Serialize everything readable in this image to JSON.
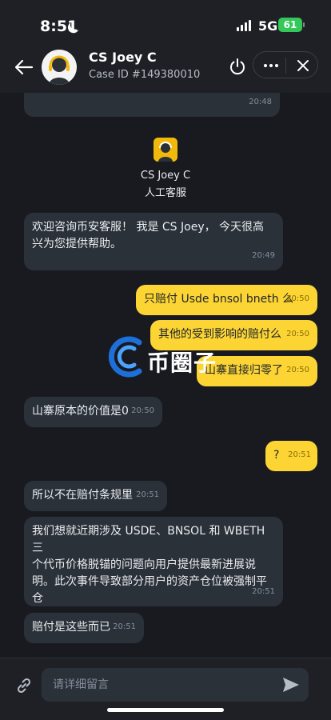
{
  "status_bar": {
    "time": "8:51",
    "network": "5G",
    "battery": "61"
  },
  "header": {
    "agent_name": "CS Joey C",
    "case_id": "Case ID #149380010"
  },
  "chat": {
    "prev_time": "20:48",
    "agent_card": {
      "name": "CS Joey C",
      "role": "人工客服"
    },
    "messages": [
      {
        "dir": "in",
        "lines": [
          "欢迎咨询币安客服！ 我是 CS Joey， 今天很高",
          "兴为您提供帮助。"
        ],
        "time": "20:49"
      },
      {
        "dir": "out",
        "lines": [
          "只赔付 Usde bnsol bneth 么"
        ],
        "time": "20:50"
      },
      {
        "dir": "out",
        "lines": [
          "其他的受到影响的赔付么"
        ],
        "time": "20:50"
      },
      {
        "dir": "out",
        "lines": [
          "山寨直接归零了"
        ],
        "time": "20:50"
      },
      {
        "dir": "in",
        "lines": [
          "山寨原本的价值是0"
        ],
        "time": "20:50"
      },
      {
        "dir": "out",
        "lines": [
          "?"
        ],
        "time": "20:51"
      },
      {
        "dir": "in",
        "lines": [
          "所以不在赔付条规里"
        ],
        "time": "20:51"
      },
      {
        "dir": "in",
        "lines": [
          "我们想就近期涉及 USDE、BNSOL 和 WBETH 三",
          "个代币价格脱锚的问题向用户提供最新进展说",
          "明。此次事件导致部分用户的资产仓位被强制平",
          "仓"
        ],
        "time": "20:51"
      },
      {
        "dir": "in",
        "lines": [
          "赔付是这些而已"
        ],
        "time": "20:51"
      }
    ]
  },
  "watermark": {
    "text": "币圈子"
  },
  "input": {
    "placeholder": "请详细留言"
  },
  "colors": {
    "background": "#181a20",
    "incoming_bubble": "#2b3139",
    "outgoing_bubble": "#fcd535",
    "accent": "#f0b90b"
  },
  "icons": [
    "back-arrow-icon",
    "power-icon",
    "more-icon",
    "close-icon",
    "link-icon",
    "send-icon"
  ]
}
